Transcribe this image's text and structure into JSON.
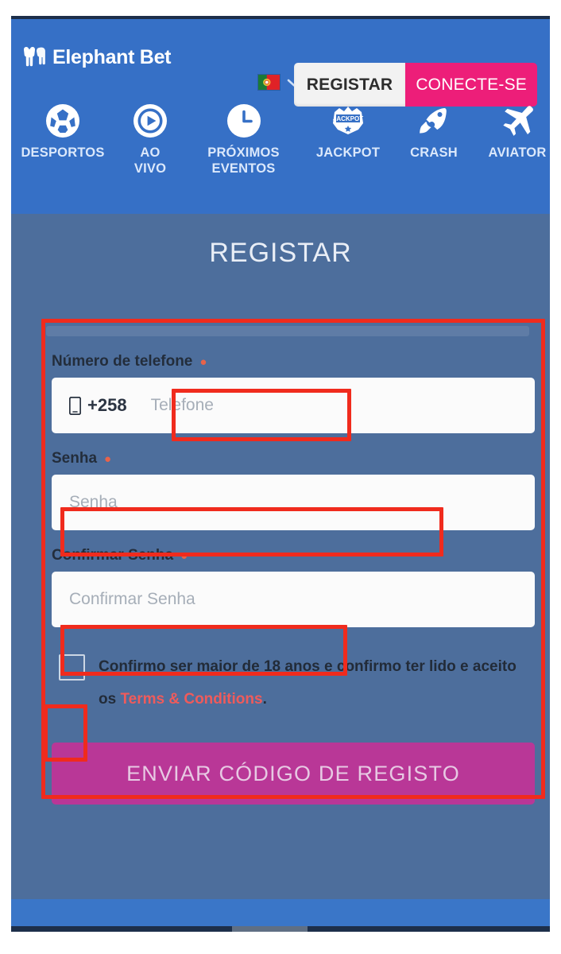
{
  "header": {
    "logo_text": "Elephant Bet",
    "logo_icon": "elephant-icon",
    "language": {
      "flag_icon": "portugal-flag-icon",
      "chevron_icon": "chevron-down-icon"
    },
    "register_button": "REGISTAR",
    "login_button": "CONECTE-SE",
    "colors": {
      "header_blue": "#3670c6",
      "login_pink": "#ed1e79",
      "register_bg": "#f2f2f2"
    }
  },
  "nav": {
    "items": [
      {
        "label": "DESPORTOS",
        "icon": "football-icon"
      },
      {
        "label": "AO\nVIVO",
        "icon": "live-play-icon"
      },
      {
        "label": "PRÓXIMOS\nEVENTOS",
        "icon": "clock-icon"
      },
      {
        "label": "JACKPOT",
        "icon": "jackpot-badge-icon"
      },
      {
        "label": "CRASH",
        "icon": "rocket-icon"
      },
      {
        "label": "AVIATOR",
        "icon": "airplane-icon"
      }
    ]
  },
  "main": {
    "title": "REGISTAR",
    "background_color": "#4d6e9c",
    "fields": {
      "phone": {
        "label": "Número de telefone",
        "required_marker": "●",
        "prefix_icon": "mobile-phone-icon",
        "country_code": "+258",
        "placeholder": "Telefone",
        "value": ""
      },
      "password": {
        "label": "Senha",
        "required_marker": "●",
        "placeholder": "Senha",
        "value": ""
      },
      "confirm_password": {
        "label": "Confirmar Senha",
        "required_marker": "●",
        "placeholder": "Confirmar Senha",
        "value": ""
      }
    },
    "terms": {
      "text_before": "Confirmo ser maior de 18 anos e confirmo ter lido e aceito os ",
      "link_text": "Terms & Conditions",
      "text_after": ".",
      "checked": false,
      "link_color": "#ef5b5b"
    },
    "submit_button": {
      "label": "ENVIAR CÓDIGO DE REGISTO",
      "color": "#b93797"
    }
  },
  "annotations": {
    "color": "#f02b1d",
    "boxes": [
      {
        "name": "form-container-highlight"
      },
      {
        "name": "phone-input-highlight"
      },
      {
        "name": "password-input-highlight"
      },
      {
        "name": "confirm-password-input-highlight"
      },
      {
        "name": "terms-checkbox-highlight"
      }
    ]
  }
}
